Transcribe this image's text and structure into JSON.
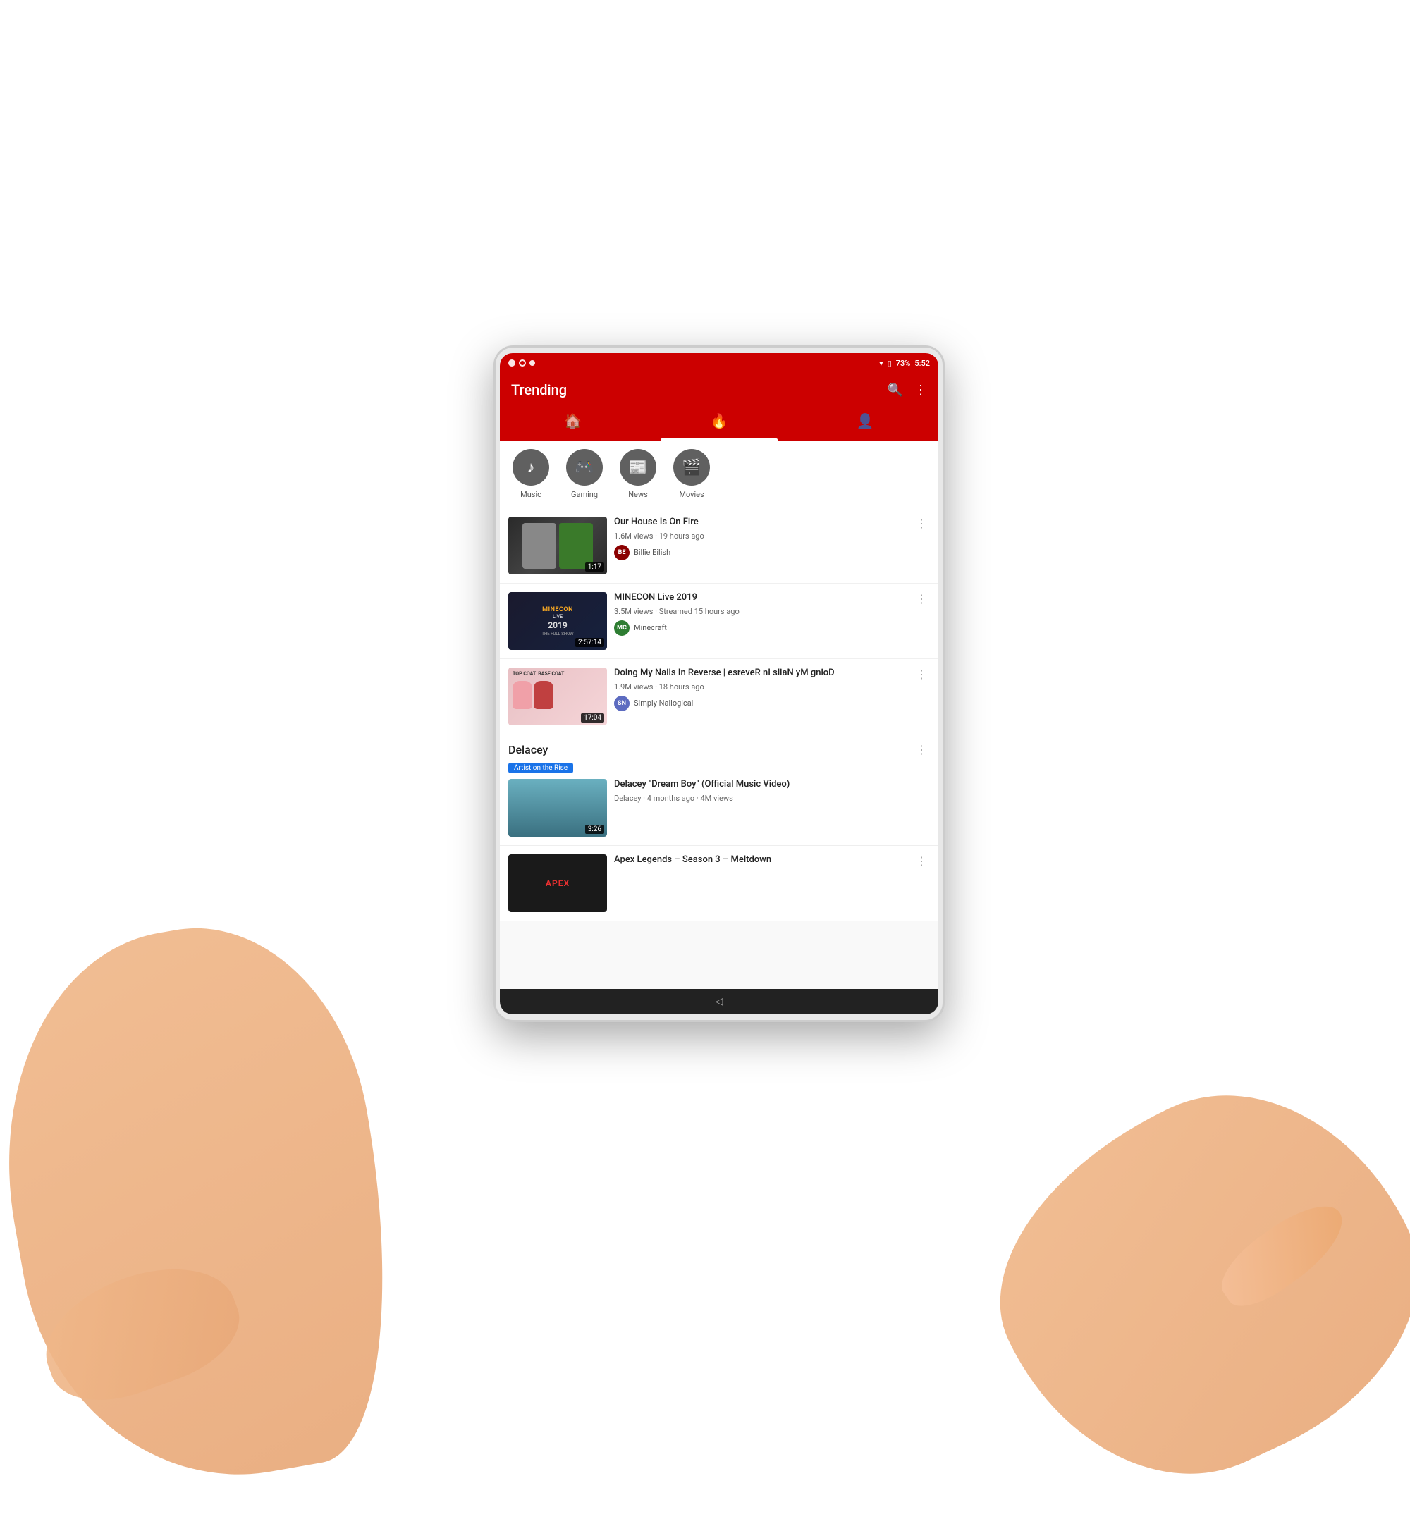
{
  "statusBar": {
    "time": "5:52",
    "battery": "73%",
    "icons": [
      "notification-dot",
      "n-icon",
      "circle-icon"
    ]
  },
  "header": {
    "title": "Trending",
    "search_label": "Search",
    "more_label": "More options"
  },
  "navTabs": [
    {
      "id": "home",
      "icon": "🏠",
      "active": false
    },
    {
      "id": "trending",
      "icon": "🔥",
      "active": true
    },
    {
      "id": "account",
      "icon": "👤",
      "active": false
    }
  ],
  "categories": [
    {
      "id": "music",
      "label": "Music",
      "icon": "♪"
    },
    {
      "id": "gaming",
      "label": "Gaming",
      "icon": "🎮"
    },
    {
      "id": "news",
      "label": "News",
      "icon": "📰"
    },
    {
      "id": "movies",
      "label": "Movies",
      "icon": "🎬"
    }
  ],
  "videos": [
    {
      "id": "v1",
      "title": "Our House Is On Fire",
      "views": "1.6M views · 19 hours ago",
      "channel": "Billie Eilish",
      "duration": "1:17",
      "thumb_type": "billie"
    },
    {
      "id": "v2",
      "title": "MINECON Live 2019",
      "views": "3.5M views · Streamed 15 hours ago",
      "channel": "Minecraft",
      "duration": "2:57:14",
      "thumb_type": "minecon"
    },
    {
      "id": "v3",
      "title": "Doing My Nails In Reverse | esreveR nI sliaN yM gnioD",
      "views": "1.9M views · 18 hours ago",
      "channel": "Simply Nailogical",
      "duration": "17:04",
      "thumb_type": "nail"
    }
  ],
  "artistSection": {
    "name": "Delacey",
    "badge": "Artist on the Rise",
    "videoTitle": "Delacey \"Dream Boy\" (Official Music Video)",
    "videoMeta": "Delacey · 4 months ago · 4M views",
    "duration": "3:26"
  },
  "apexVideo": {
    "title": "Apex Legends – Season 3 – Meltdown",
    "thumb_type": "apex"
  },
  "bottomNav": {
    "back_icon": "◁"
  }
}
